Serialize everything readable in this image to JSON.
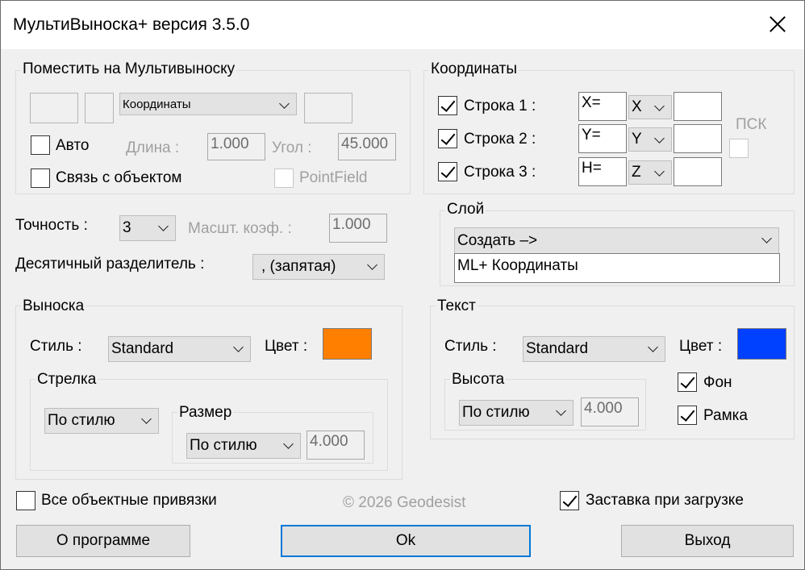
{
  "window": {
    "title": "МультиВыноска+ версия 3.5.0"
  },
  "colors": {
    "leader": "#ff7f00",
    "text": "#0040ff",
    "default_button_border": "#0078d7"
  },
  "place": {
    "group_label": "Поместить на Мультивыноску",
    "dropdown": "Координаты",
    "auto": {
      "label": "Авто",
      "checked": false
    },
    "length": {
      "label": "Длина :",
      "value": "1.000"
    },
    "angle": {
      "label": "Угол :",
      "value": "45.000"
    },
    "link": {
      "label": "Связь с объектом",
      "checked": false
    },
    "pointfield": {
      "label": "PointField",
      "checked": false,
      "enabled": false
    }
  },
  "coordinates": {
    "group_label": "Координаты",
    "rows": [
      {
        "label": "Строка 1 :",
        "checked": true,
        "prefix": "X=",
        "axis": "X"
      },
      {
        "label": "Строка 2 :",
        "checked": true,
        "prefix": "Y=",
        "axis": "Y"
      },
      {
        "label": "Строка 3 :",
        "checked": true,
        "prefix": "H=",
        "axis": "Z"
      }
    ],
    "ucs": {
      "label": "ПСК",
      "checked": false,
      "enabled": false
    }
  },
  "precision": {
    "label": "Точность :",
    "value": "3",
    "scale_label": "Масшт. коэф. :",
    "scale_value": "1.000"
  },
  "decimal": {
    "label": "Десятичный разделитель :",
    "value": ", (запятая)"
  },
  "layer": {
    "group_label": "Слой",
    "dropdown": "Создать –>",
    "name": "ML+ Координаты"
  },
  "leader": {
    "group_label": "Выноска",
    "style_label": "Стиль :",
    "style_value": "Standard",
    "color_label": "Цвет :",
    "arrow": {
      "group_label": "Стрелка",
      "value": "По стилю",
      "size": {
        "group_label": "Размер",
        "value": "По стилю",
        "number": "4.000"
      }
    }
  },
  "text": {
    "group_label": "Текст",
    "style_label": "Стиль :",
    "style_value": "Standard",
    "color_label": "Цвет :",
    "height": {
      "group_label": "Высота",
      "value": "По стилю",
      "number": "4.000"
    },
    "background": {
      "label": "Фон",
      "checked": true
    },
    "frame": {
      "label": "Рамка",
      "checked": true
    }
  },
  "bottom": {
    "snaps": {
      "label": "Все объектные привязки",
      "checked": false
    },
    "copyright": "© 2026 Geodesist",
    "splash": {
      "label": "Заставка при загрузке",
      "checked": true
    },
    "about_button": "О программе",
    "ok_button": "Ok",
    "exit_button": "Выход"
  }
}
